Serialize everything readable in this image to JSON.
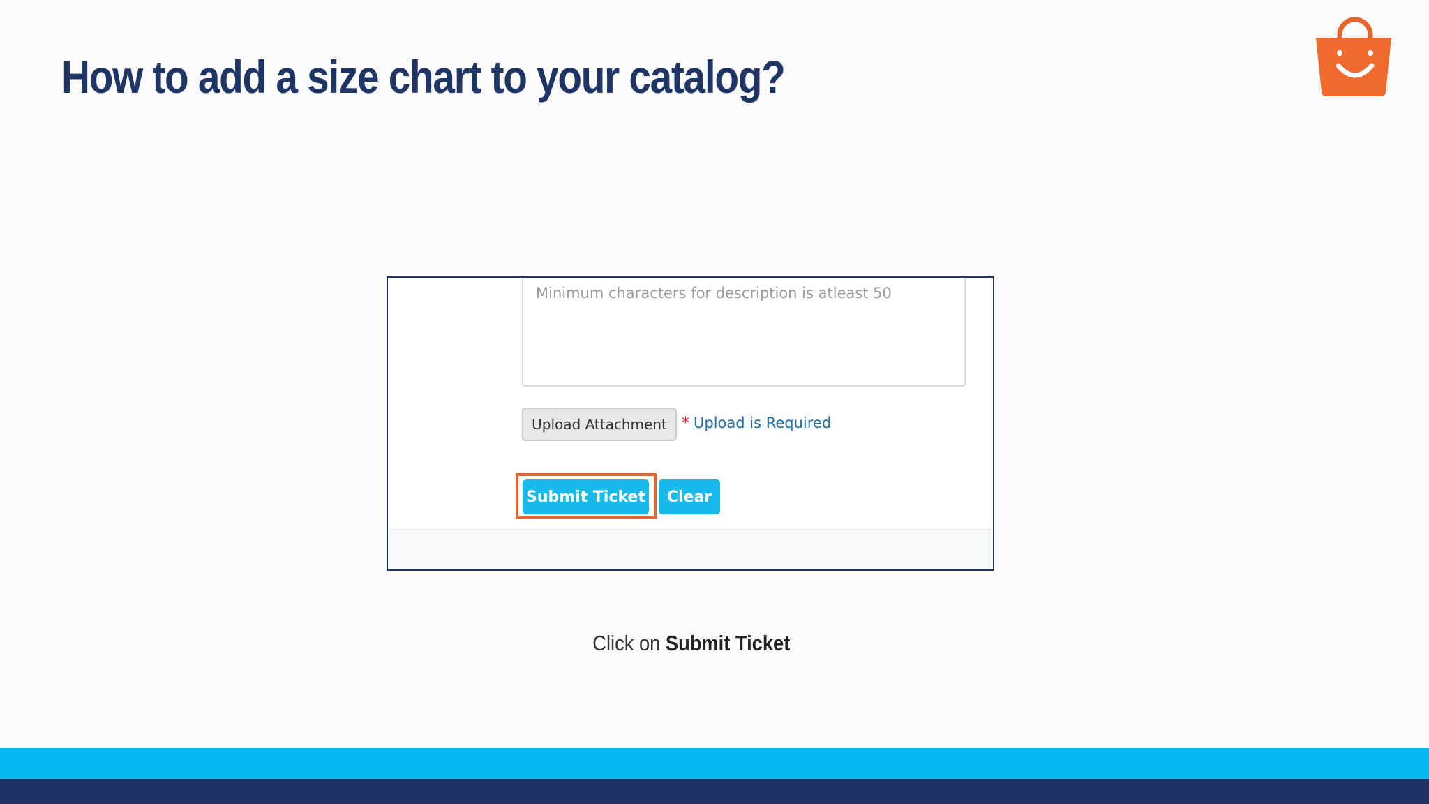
{
  "slide": {
    "title": "How to add a size chart to your catalog?",
    "logo_icon": "shopping-bag-icon",
    "accent_color": "#e8642a",
    "title_color": "#1f3566"
  },
  "form": {
    "description_placeholder": "Minimum characters for description is atleast 50",
    "upload_button_label": "Upload Attachment",
    "required_marker": "*",
    "upload_required_text": "Upload is Required",
    "submit_button_label": "Submit Ticket",
    "clear_button_label": "Clear",
    "button_color": "#17baea"
  },
  "caption": {
    "prefix": "Click on ",
    "emphasis": "Submit Ticket"
  },
  "footer": {
    "light_band_color": "#05b9ee",
    "dark_band_color": "#1f3166"
  }
}
